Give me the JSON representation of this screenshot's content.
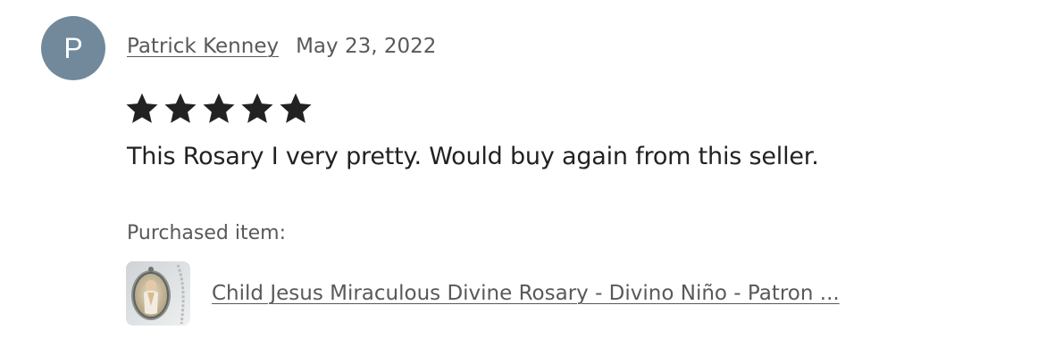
{
  "review": {
    "avatar_initial": "P",
    "reviewer_name": "Patrick Kenney",
    "date": "May 23, 2022",
    "rating": 5,
    "rating_max": 5,
    "star_color": "#222222",
    "text": "This Rosary I very pretty. Would buy again from this seller.",
    "purchased_label": "Purchased item:",
    "item": {
      "title": "Child Jesus Miraculous Divine Rosary - Divino Niño - Patron ...",
      "thumbnail_icon": "rosary-medal-thumbnail"
    }
  },
  "colors": {
    "avatar_bg": "#71899b",
    "muted_text": "#595959",
    "body_text": "#222222"
  }
}
